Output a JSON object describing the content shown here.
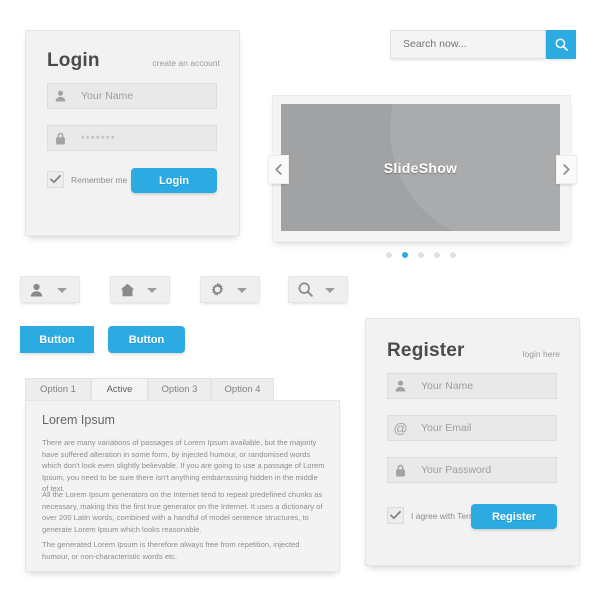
{
  "login": {
    "title": "Login",
    "link": "create an account",
    "fields": [
      {
        "icon": "user-icon",
        "placeholder": "Your Name",
        "value": ""
      },
      {
        "icon": "lock-icon",
        "placeholder": "",
        "value": "*******"
      }
    ],
    "remember_label": "Remember me",
    "submit_label": "Login"
  },
  "search": {
    "placeholder": "Search now...",
    "value": "",
    "icon": "search-icon"
  },
  "slideshow": {
    "label": "SlideShow",
    "prev_icon": "chevron-left-icon",
    "next_icon": "chevron-right-icon",
    "dot_count": 5,
    "active_dot": 2
  },
  "dropdowns": [
    {
      "icon": "user-icon",
      "caret": "chevron-down-icon"
    },
    {
      "icon": "home-icon",
      "caret": "chevron-down-icon"
    },
    {
      "icon": "gear-icon",
      "caret": "chevron-down-icon"
    },
    {
      "icon": "search-icon",
      "caret": "chevron-down-icon"
    }
  ],
  "buttons": [
    {
      "label": "Button",
      "shape": "square"
    },
    {
      "label": "Button",
      "shape": "rounded"
    }
  ],
  "tabs": {
    "items": [
      {
        "label": "Option 1",
        "active": false
      },
      {
        "label": "Active",
        "active": true
      },
      {
        "label": "Option 3",
        "active": false
      },
      {
        "label": "Option 4",
        "active": false
      }
    ],
    "panel": {
      "title": "Lorem Ipsum",
      "paragraphs": [
        "There are many variations of passages of Lorem Ipsum available, but the majority have suffered alteration in some form, by injected humour, or randomised words which don't look even slightly believable. If you are going to use a passage of Lorem Ipsum, you need to be sure there isn't anything embarrassing hidden in the middle of text.",
        "All the Lorem Ipsum generators on the Internet tend to repeat predefined chunks as necessary, making this the first true generator on the Internet. It uses a dictionary of over 200 Latin words, combined with a handful of model sentence structures, to generate Lorem Ipsum which looks reasonable.",
        "The generated Lorem Ipsum is therefore always free from repetition, injected humour, or non-characteristic words etc."
      ]
    }
  },
  "register": {
    "title": "Register",
    "link": "login here",
    "fields": [
      {
        "icon": "user-icon",
        "placeholder": "Your Name",
        "value": ""
      },
      {
        "icon": "at-icon",
        "placeholder": "Your Email",
        "value": ""
      },
      {
        "icon": "lock-icon",
        "placeholder": "Your Password",
        "value": ""
      }
    ],
    "terms_label": "I agree with Terms",
    "submit_label": "Register"
  },
  "colors": {
    "accent": "#2babe2",
    "panel_bg": "#f2f2f2",
    "field_bg": "#e9e9e9",
    "slide_bg": "#a0a2a4",
    "text_muted": "#9a9a9a"
  }
}
